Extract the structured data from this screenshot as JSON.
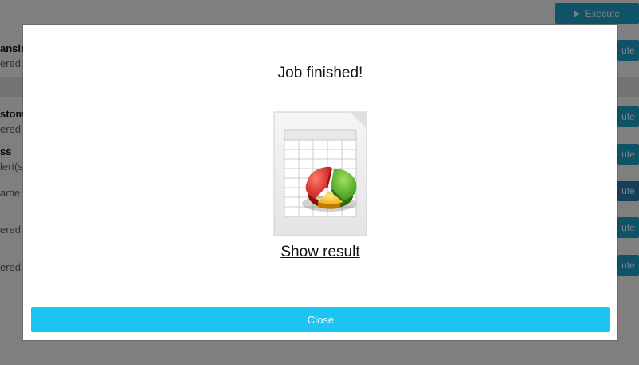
{
  "background": {
    "items": [
      {
        "title": "ansin",
        "subtitle": "ered"
      },
      {
        "title": "stom",
        "subtitle": "ered"
      },
      {
        "title": "ss",
        "subtitle": "lert(s"
      },
      {
        "title": "",
        "subtitle": "ame c"
      },
      {
        "title": "",
        "subtitle": "ered"
      },
      {
        "title": "",
        "subtitle": "ered"
      }
    ],
    "execute_label": "Execute",
    "execute_partial_label": "ute"
  },
  "modal": {
    "title": "Job finished!",
    "icon": "spreadsheet-pie-chart-icon",
    "link_label": "Show result",
    "close_label": "Close"
  },
  "colors": {
    "overlay": "rgba(0,0,0,0.5)",
    "close_button": "#1cc3f3",
    "execute_button": "#1fa7d2"
  }
}
